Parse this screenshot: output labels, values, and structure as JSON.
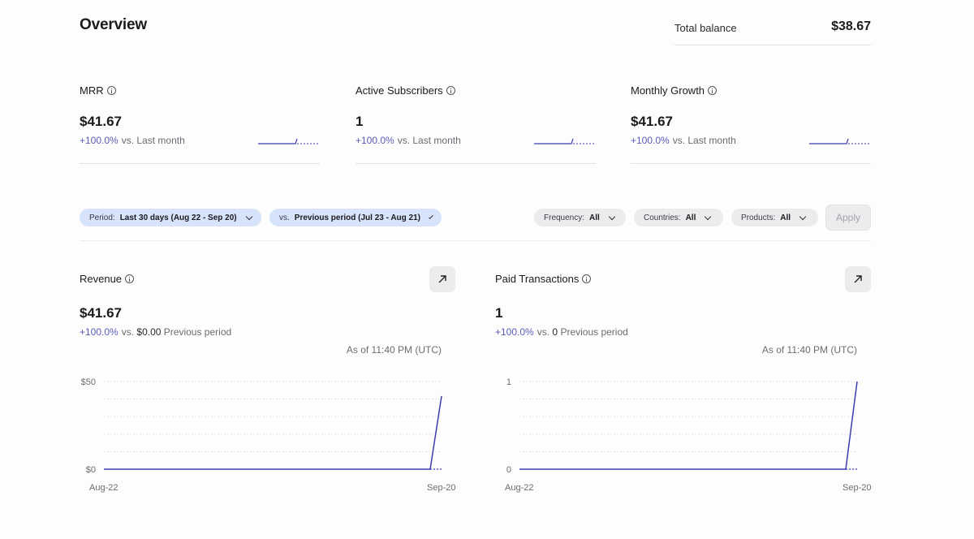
{
  "header": {
    "title": "Overview"
  },
  "balance": {
    "label": "Total balance",
    "value": "$38.67"
  },
  "metrics": [
    {
      "label": "MRR",
      "value": "$41.67",
      "change": "+100.0%",
      "compare": "vs. Last month",
      "spark": [
        0,
        0,
        0,
        0,
        0,
        0,
        0,
        0,
        0,
        0,
        1
      ]
    },
    {
      "label": "Active Subscribers",
      "value": "1",
      "change": "+100.0%",
      "compare": "vs. Last month",
      "spark": [
        0,
        0,
        0,
        0,
        0,
        0,
        0,
        0,
        0,
        0,
        1
      ]
    },
    {
      "label": "Monthly Growth",
      "value": "$41.67",
      "change": "+100.0%",
      "compare": "vs. Last month",
      "spark": [
        0,
        0,
        0,
        0,
        0,
        0,
        0,
        0,
        0,
        0,
        1
      ]
    }
  ],
  "filters": {
    "period_key": "Period:",
    "period_value": "Last 30 days (Aug 22 - Sep 20)",
    "vs_key": "vs.",
    "vs_value": "Previous period (Jul 23 - Aug 21)",
    "frequency_key": "Frequency:",
    "frequency_value": "All",
    "countries_key": "Countries:",
    "countries_value": "All",
    "products_key": "Products:",
    "products_value": "All",
    "apply_label": "Apply"
  },
  "panels": [
    {
      "label": "Revenue",
      "value": "$41.67",
      "change": "+100.0%",
      "vs_text": "vs.",
      "ref_value": "$0.00",
      "ref_label": "Previous period",
      "as_of": "As of 11:40 PM (UTC)"
    },
    {
      "label": "Paid Transactions",
      "value": "1",
      "change": "+100.0%",
      "vs_text": "vs.",
      "ref_value": "0",
      "ref_label": "Previous period",
      "as_of": "As of 11:40 PM (UTC)"
    }
  ],
  "chart_data": [
    {
      "type": "line",
      "title": "Revenue",
      "x": [
        "Aug-22",
        "Sep-20"
      ],
      "xticks": [
        "Aug-22",
        "Sep-20"
      ],
      "yticks": [
        "$0",
        "$50"
      ],
      "ylim": [
        0,
        50
      ],
      "series": [
        {
          "values": [
            0,
            0,
            0,
            0,
            0,
            0,
            0,
            0,
            0,
            0,
            0,
            0,
            0,
            0,
            0,
            0,
            0,
            0,
            0,
            0,
            0,
            0,
            0,
            0,
            0,
            0,
            0,
            0,
            0,
            41.67
          ]
        },
        {
          "values": [
            0,
            0,
            0,
            0,
            0,
            0,
            0,
            0,
            0,
            0,
            0,
            0,
            0,
            0,
            0,
            0,
            0,
            0,
            0,
            0,
            0,
            0,
            0,
            0,
            0,
            0,
            0,
            0,
            0,
            0
          ],
          "dashed": true
        }
      ],
      "grid": true,
      "color": "#3c3cb0"
    },
    {
      "type": "line",
      "title": "Paid Transactions",
      "x": [
        "Aug-22",
        "Sep-20"
      ],
      "xticks": [
        "Aug-22",
        "Sep-20"
      ],
      "yticks": [
        "0",
        "1"
      ],
      "ylim": [
        0,
        1
      ],
      "series": [
        {
          "values": [
            0,
            0,
            0,
            0,
            0,
            0,
            0,
            0,
            0,
            0,
            0,
            0,
            0,
            0,
            0,
            0,
            0,
            0,
            0,
            0,
            0,
            0,
            0,
            0,
            0,
            0,
            0,
            0,
            0,
            1
          ]
        },
        {
          "values": [
            0,
            0,
            0,
            0,
            0,
            0,
            0,
            0,
            0,
            0,
            0,
            0,
            0,
            0,
            0,
            0,
            0,
            0,
            0,
            0,
            0,
            0,
            0,
            0,
            0,
            0,
            0,
            0,
            0,
            0
          ],
          "dashed": true
        }
      ],
      "grid": true,
      "color": "#3c3cb0"
    }
  ]
}
